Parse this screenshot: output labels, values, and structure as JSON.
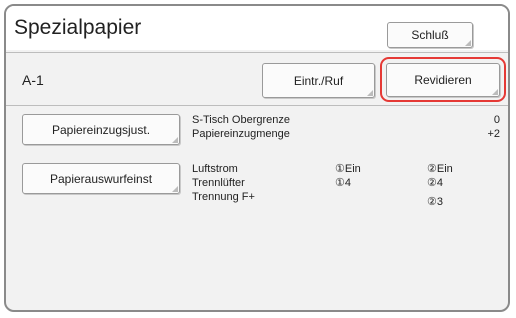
{
  "header": {
    "title": "Spezialpapier",
    "close_label": "Schluß"
  },
  "job": {
    "id": "A-1",
    "entry_recall_label": "Eintr./Ruf",
    "revise_label": "Revidieren"
  },
  "paper_feed": {
    "button_label": "Papiereinzugsjust.",
    "rows": [
      {
        "label": "S-Tisch Obergrenze",
        "value": "0"
      },
      {
        "label": "Papiereinzugmenge",
        "value": "+2"
      }
    ]
  },
  "paper_eject": {
    "button_label": "Papierauswurfeinst",
    "rows": [
      {
        "label": "Luftstrom",
        "col1": "①Ein",
        "col2": "②Ein"
      },
      {
        "label": "Trennlüfter",
        "col1": "①4",
        "col2": "②4"
      },
      {
        "label": "Trennung F+",
        "col1": "",
        "col2": "②3"
      }
    ]
  },
  "colors": {
    "highlight": "#e53935",
    "panel_bg": "#f2f2f2",
    "border": "#8a8a8a"
  }
}
